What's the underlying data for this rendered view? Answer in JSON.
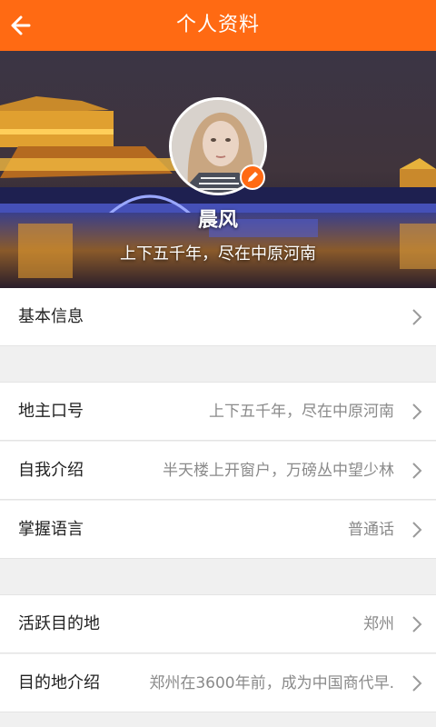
{
  "header": {
    "title": "个人资料"
  },
  "profile": {
    "nickname": "晨风",
    "motto": "上下五千年，尽在中原河南"
  },
  "sections": [
    {
      "rows": [
        {
          "label": "基本信息",
          "value": ""
        }
      ]
    },
    {
      "rows": [
        {
          "label": "地主口号",
          "value": "上下五千年，尽在中原河南"
        },
        {
          "label": "自我介绍",
          "value": "半天楼上开窗户，万磅丛中望少林"
        },
        {
          "label": "掌握语言",
          "value": "普通话"
        }
      ]
    },
    {
      "rows": [
        {
          "label": "活跃目的地",
          "value": "郑州"
        },
        {
          "label": "目的地介绍",
          "value": "郑州在3600年前，成为中国商代早."
        }
      ]
    }
  ],
  "colors": {
    "accent": "#ff6a13",
    "text": "#222222",
    "muted": "#8a8a8a",
    "background": "#f0f0f0"
  },
  "icons": {
    "back": "arrow-left-icon",
    "chevron": "chevron-right-icon",
    "edit": "pencil-icon"
  }
}
